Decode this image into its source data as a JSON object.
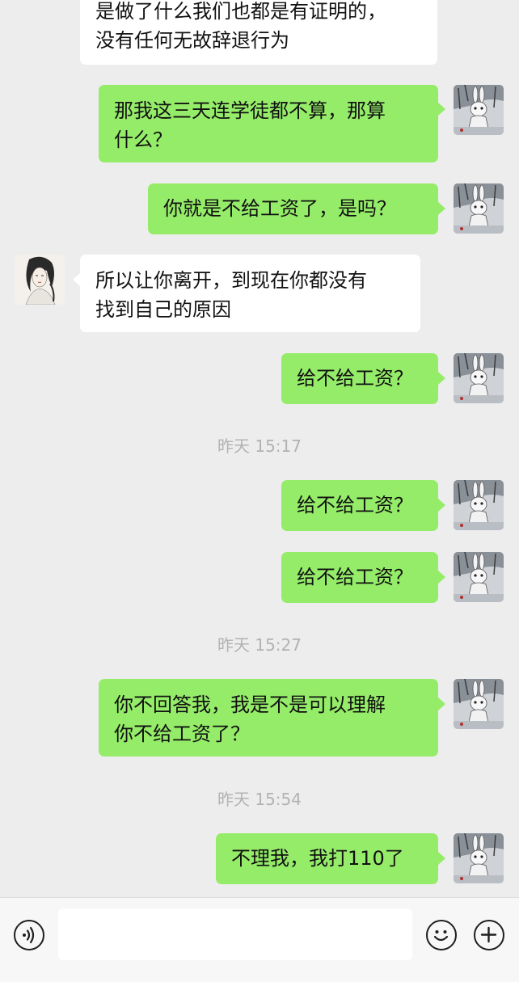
{
  "messages": [
    {
      "text": "是做了什么我们也都是有证明的，\n没有任何无故辞退行为"
    },
    {
      "text": "那我这三天连学徒都不算，那算\n什么？"
    },
    {
      "text": "你就是不给工资了，是吗？"
    },
    {
      "text": "所以让你离开，到现在你都没有\n找到自己的原因"
    },
    {
      "text": "给不给工资？"
    },
    {
      "text": "给不给工资？"
    },
    {
      "text": "给不给工资？"
    },
    {
      "text": "你不回答我，我是不是可以理解\n你不给工资了？"
    },
    {
      "text": "不理我，我打110了"
    }
  ],
  "timestamps": [
    "昨天 15:17",
    "昨天 15:27",
    "昨天 15:54"
  ],
  "input_bar": {
    "voice_icon": "voice-icon",
    "emoji_icon": "emoji-icon",
    "add_icon": "plus-icon",
    "text_value": ""
  },
  "colors": {
    "sent_bubble": "#95ec69",
    "received_bubble": "#ffffff",
    "background": "#ededed",
    "timestamp_text": "#b2b2b2"
  }
}
